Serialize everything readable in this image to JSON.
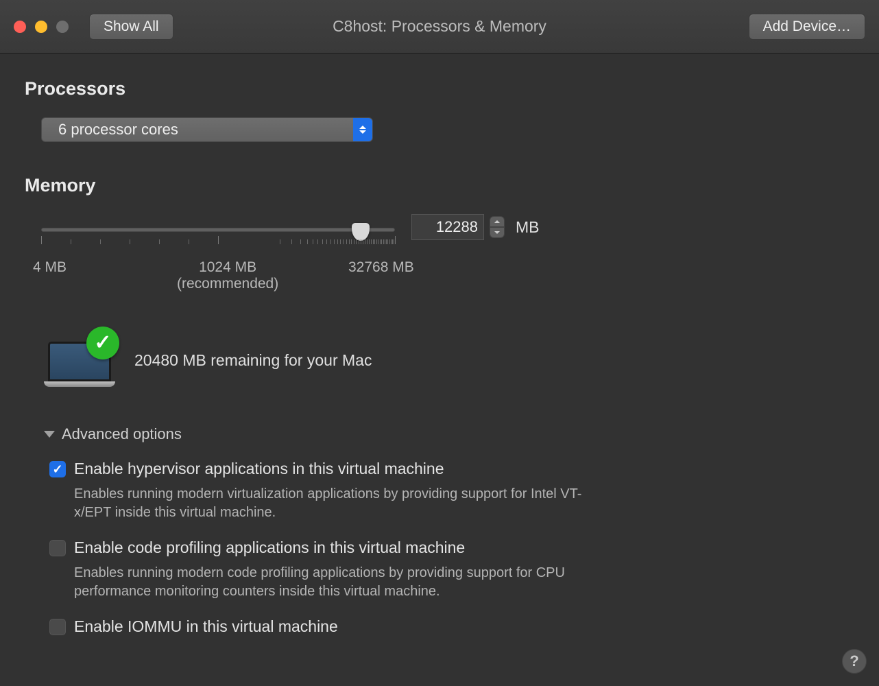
{
  "window": {
    "title": "C8host: Processors & Memory"
  },
  "toolbar": {
    "show_all": "Show All",
    "add_device": "Add Device…"
  },
  "processors": {
    "heading": "Processors",
    "selected": "6  processor cores"
  },
  "memory": {
    "heading": "Memory",
    "value": "12288",
    "unit": "MB",
    "slider": {
      "min_label": "4 MB",
      "recommended_label": "1024 MB",
      "recommended_sub": "(recommended)",
      "max_label": "32768 MB"
    },
    "remaining": "20480 MB remaining for your Mac"
  },
  "advanced": {
    "heading": "Advanced options",
    "hypervisor": {
      "label": "Enable hypervisor applications in this virtual machine",
      "desc": "Enables running modern virtualization applications by providing support for Intel VT-x/EPT inside this virtual machine.",
      "checked": true
    },
    "profiling": {
      "label": "Enable code profiling applications in this virtual machine",
      "desc": "Enables running modern code profiling applications by providing support for CPU performance monitoring counters inside this virtual machine.",
      "checked": false
    },
    "iommu": {
      "label": "Enable IOMMU in this virtual machine",
      "checked": false
    }
  },
  "help": {
    "label": "?"
  }
}
